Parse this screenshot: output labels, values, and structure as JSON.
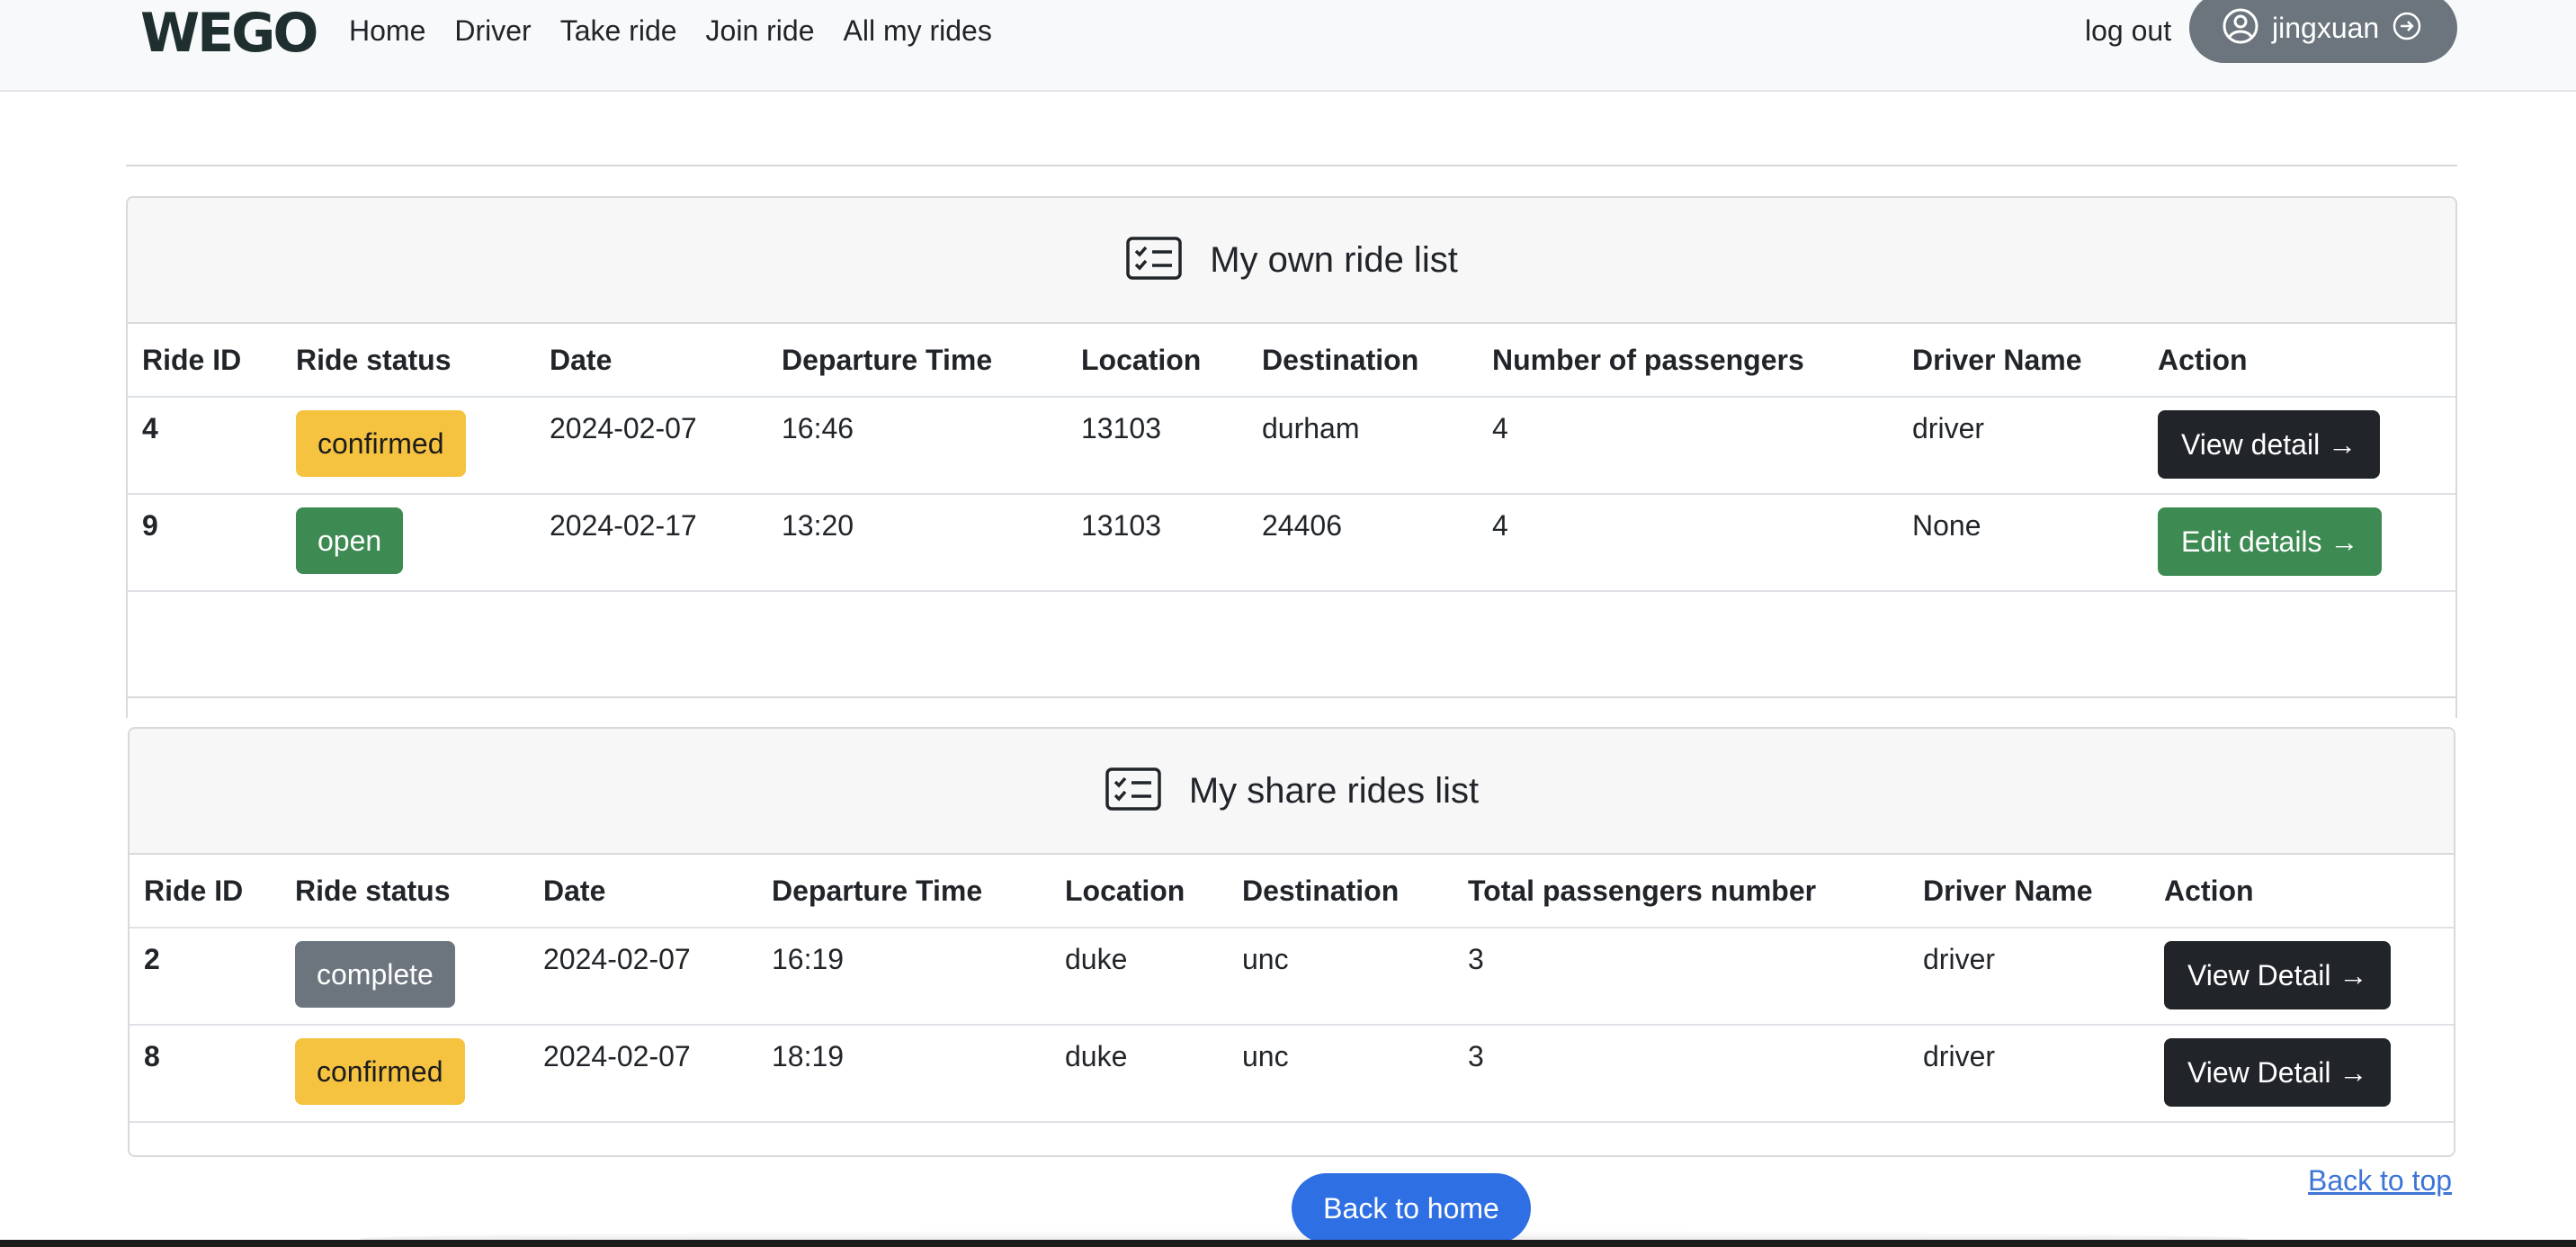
{
  "navbar": {
    "brand": "WEGO",
    "links": [
      "Home",
      "Driver",
      "Take ride",
      "Join ride",
      "All my rides"
    ],
    "logout": "log out",
    "username": "jingxuan"
  },
  "own_rides": {
    "title": "My own ride list",
    "columns": [
      "Ride ID",
      "Ride status",
      "Date",
      "Departure Time",
      "Location",
      "Destination",
      "Number of passengers",
      "Driver Name",
      "Action"
    ],
    "rows": [
      {
        "id": "4",
        "status": "confirmed",
        "date": "2024-02-07",
        "time": "16:46",
        "location": "13103",
        "destination": "durham",
        "passengers": "4",
        "driver": "driver",
        "action": "View detail →"
      },
      {
        "id": "9",
        "status": "open",
        "date": "2024-02-17",
        "time": "13:20",
        "location": "13103",
        "destination": "24406",
        "passengers": "4",
        "driver": "None",
        "action": "Edit details →"
      }
    ]
  },
  "share_rides": {
    "title": "My share rides list",
    "columns": [
      "Ride ID",
      "Ride status",
      "Date",
      "Departure Time",
      "Location",
      "Destination",
      "Total passengers number",
      "Driver Name",
      "Action"
    ],
    "rows": [
      {
        "id": "2",
        "status": "complete",
        "date": "2024-02-07",
        "time": "16:19",
        "location": "duke",
        "destination": "unc",
        "passengers": "3",
        "driver": "driver",
        "action": "View Detail →"
      },
      {
        "id": "8",
        "status": "confirmed",
        "date": "2024-02-07",
        "time": "18:19",
        "location": "duke",
        "destination": "unc",
        "passengers": "3",
        "driver": "driver",
        "action": "View Detail →"
      }
    ]
  },
  "footer": {
    "back_home": "Back to home",
    "back_top": "Back to top"
  },
  "colors": {
    "confirmed": "#f6c341",
    "open": "#3d8a52",
    "complete": "#6c757d",
    "primary": "#2f6fe4",
    "dark_button": "#212529"
  },
  "icons": [
    "user-circle-icon",
    "arrow-circle-right-icon",
    "checklist-card-icon"
  ]
}
